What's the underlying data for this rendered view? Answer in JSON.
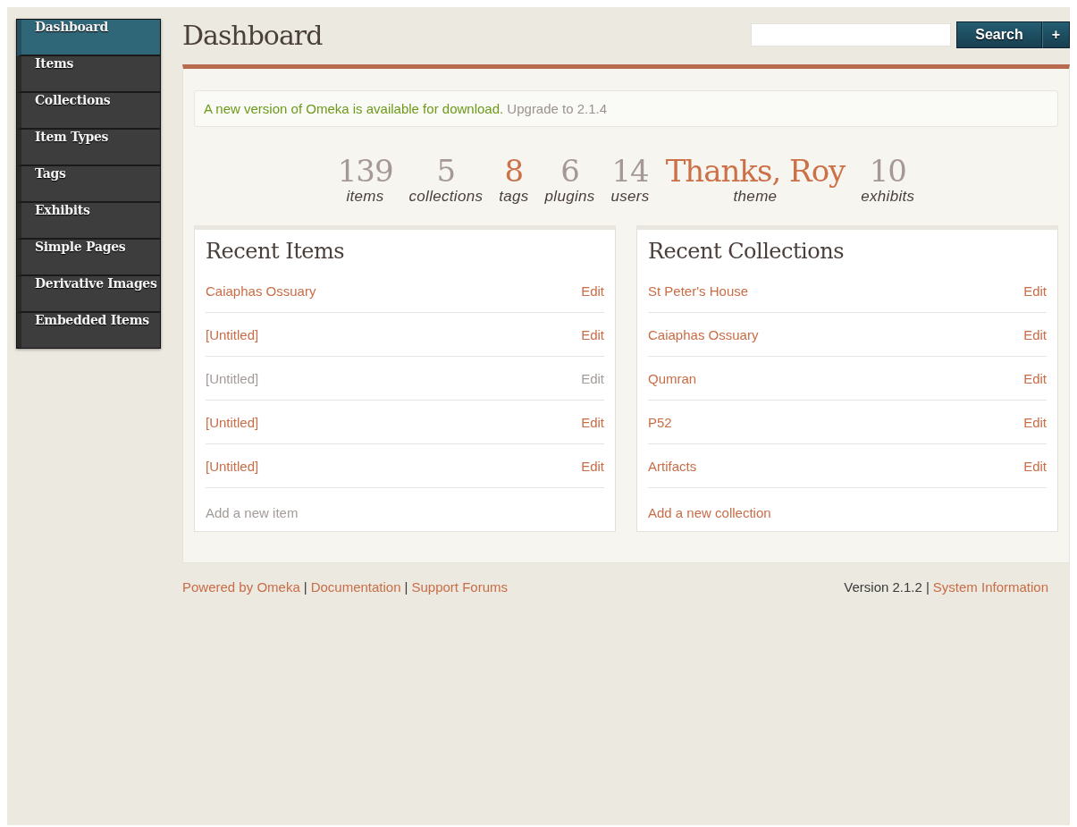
{
  "sidebar": {
    "items": [
      {
        "label": "Dashboard",
        "selected": true
      },
      {
        "label": "Items",
        "selected": false
      },
      {
        "label": "Collections",
        "selected": false
      },
      {
        "label": "Item Types",
        "selected": false
      },
      {
        "label": "Tags",
        "selected": false
      },
      {
        "label": "Exhibits",
        "selected": false
      },
      {
        "label": "Simple Pages",
        "selected": false
      },
      {
        "label": "Derivative Images",
        "selected": false
      },
      {
        "label": "Embedded Items",
        "selected": false
      }
    ]
  },
  "header": {
    "title": "Dashboard",
    "search_button": "Search",
    "add_button": "+"
  },
  "notice": {
    "message": "A new version of Omeka is available for download.",
    "link": "Upgrade to 2.1.4"
  },
  "stats": [
    {
      "value": "139",
      "label": "items",
      "highlighted": false
    },
    {
      "value": "5",
      "label": "collections",
      "highlighted": false
    },
    {
      "value": "8",
      "label": "tags",
      "highlighted": true
    },
    {
      "value": "6",
      "label": "plugins",
      "highlighted": false
    },
    {
      "value": "14",
      "label": "users",
      "highlighted": false
    },
    {
      "value": "Thanks, Roy",
      "label": "theme",
      "highlighted": true
    },
    {
      "value": "10",
      "label": "exhibits",
      "highlighted": false
    }
  ],
  "panels": [
    {
      "title": "Recent Items",
      "rows": [
        {
          "name": "Caiaphas Ossuary",
          "action": "Edit",
          "muted": false
        },
        {
          "name": "[Untitled]",
          "action": "Edit",
          "muted": false
        },
        {
          "name": "[Untitled]",
          "action": "Edit",
          "muted": true
        },
        {
          "name": "[Untitled]",
          "action": "Edit",
          "muted": false
        },
        {
          "name": "[Untitled]",
          "action": "Edit",
          "muted": false
        }
      ],
      "add_link": {
        "label": "Add a new item",
        "muted": true
      }
    },
    {
      "title": "Recent Collections",
      "rows": [
        {
          "name": "St Peter's House",
          "action": "Edit",
          "muted": false
        },
        {
          "name": "Caiaphas Ossuary",
          "action": "Edit",
          "muted": false
        },
        {
          "name": "Qumran",
          "action": "Edit",
          "muted": false
        },
        {
          "name": "P52",
          "action": "Edit",
          "muted": false
        },
        {
          "name": "Artifacts",
          "action": "Edit",
          "muted": false
        }
      ],
      "add_link": {
        "label": "Add a new collection",
        "muted": false
      }
    }
  ],
  "footer": {
    "left_links": [
      "Powered by Omeka",
      "Documentation",
      "Support Forums"
    ],
    "separator": "|",
    "version": "Version 2.1.2",
    "right_link": "System Information"
  }
}
